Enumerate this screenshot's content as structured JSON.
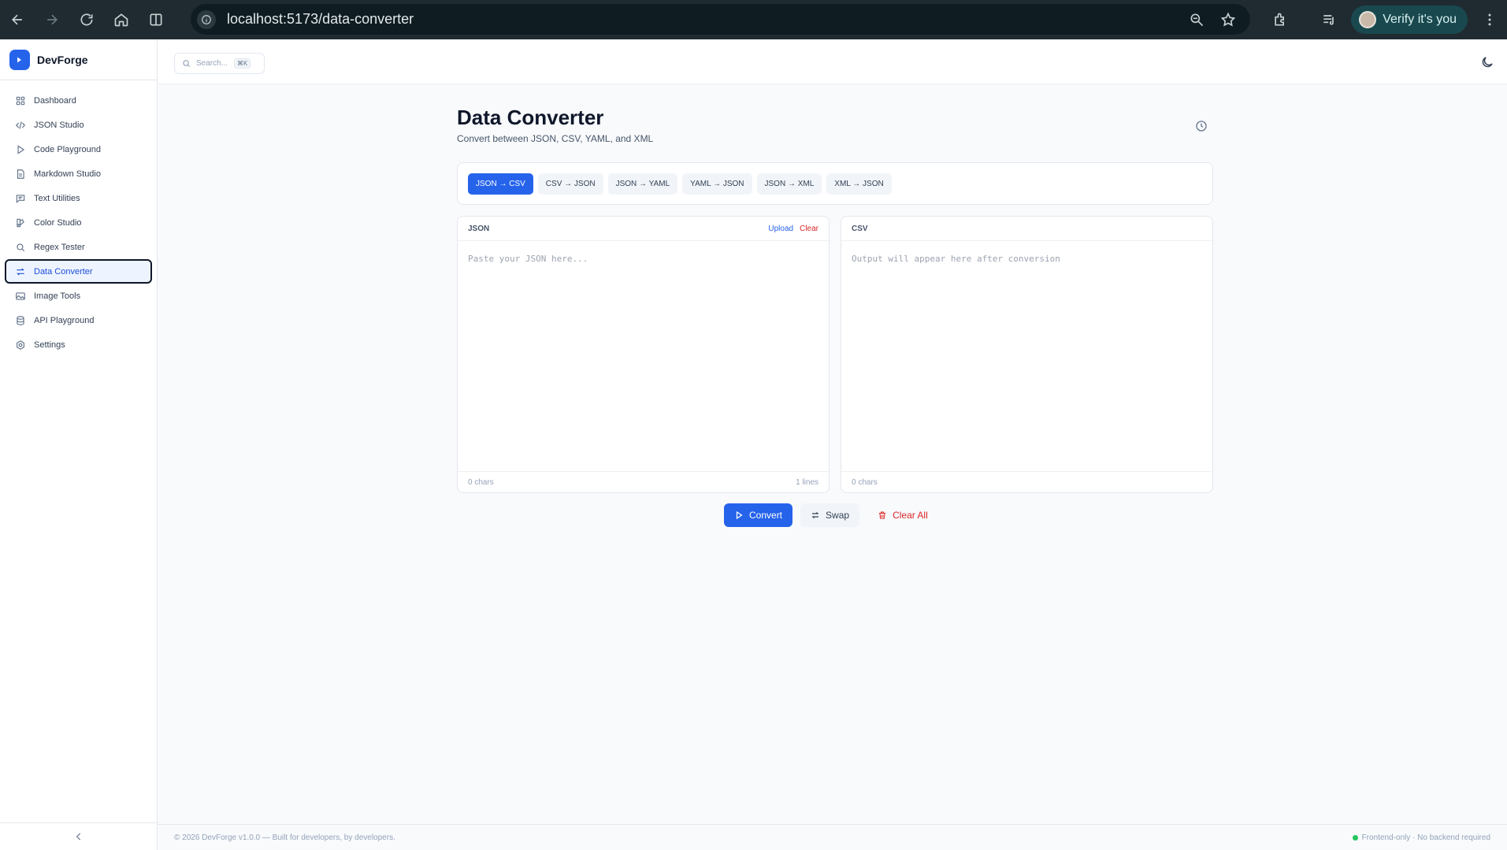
{
  "browser": {
    "url": "localhost:5173/data-converter",
    "profile_label": "Verify it's you"
  },
  "sidebar": {
    "brand": "DevForge",
    "items": [
      {
        "label": "Dashboard",
        "icon": "grid-icon"
      },
      {
        "label": "JSON Studio",
        "icon": "code-icon"
      },
      {
        "label": "Code Playground",
        "icon": "play-icon"
      },
      {
        "label": "Markdown Studio",
        "icon": "file-text-icon"
      },
      {
        "label": "Text Utilities",
        "icon": "message-square-icon"
      },
      {
        "label": "Color Studio",
        "icon": "palette-icon"
      },
      {
        "label": "Regex Tester",
        "icon": "search-icon"
      },
      {
        "label": "Data Converter",
        "icon": "arrows-swap-icon",
        "active": true
      },
      {
        "label": "Image Tools",
        "icon": "image-icon"
      },
      {
        "label": "API Playground",
        "icon": "database-icon"
      },
      {
        "label": "Settings",
        "icon": "gear-icon"
      }
    ]
  },
  "topbar": {
    "search_placeholder": "Search...",
    "search_shortcut": "⌘K"
  },
  "page": {
    "title": "Data Converter",
    "subtitle": "Convert between JSON, CSV, YAML, and XML"
  },
  "modes": [
    {
      "label": "JSON → CSV",
      "active": true
    },
    {
      "label": "CSV → JSON"
    },
    {
      "label": "JSON → YAML"
    },
    {
      "label": "YAML → JSON"
    },
    {
      "label": "JSON → XML"
    },
    {
      "label": "XML → JSON"
    }
  ],
  "input_panel": {
    "title": "JSON",
    "upload_label": "Upload",
    "clear_label": "Clear",
    "placeholder": "Paste your JSON here...",
    "chars": "0 chars",
    "lines": "1 lines"
  },
  "output_panel": {
    "title": "CSV",
    "placeholder": "Output will appear here after conversion",
    "chars": "0 chars"
  },
  "actions": {
    "convert": "Convert",
    "swap": "Swap",
    "clear_all": "Clear All"
  },
  "footer": {
    "copyright": "© 2026 DevForge v1.0.0 — Built for developers, by developers.",
    "status": "Frontend-only · No backend required"
  },
  "colors": {
    "accent": "#2563eb",
    "danger": "#dc2626",
    "status_ok": "#22c55e"
  }
}
